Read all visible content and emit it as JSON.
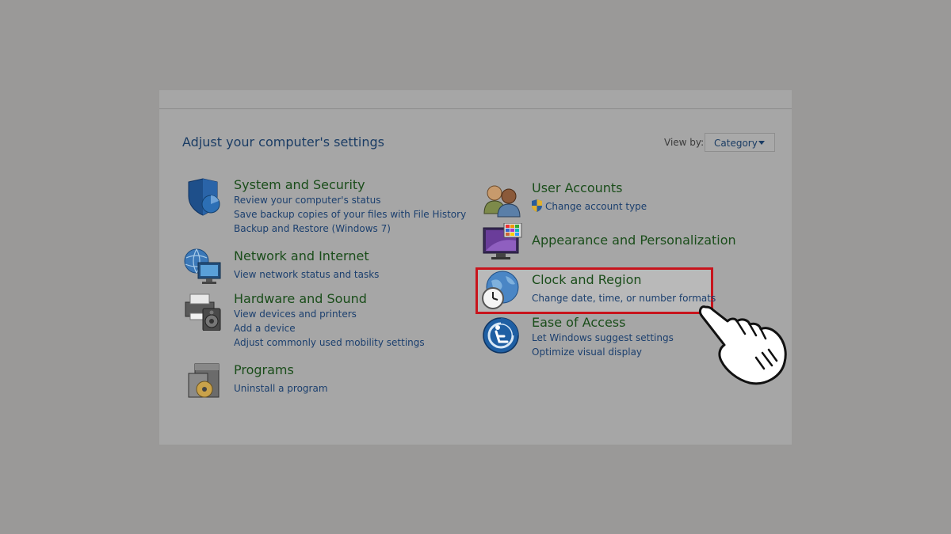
{
  "header": {
    "heading": "Adjust your computer's settings",
    "view_by_label": "View by:",
    "view_by_value": "Category"
  },
  "categories_left": [
    {
      "title": "System and Security",
      "icon": "shield-icon",
      "links": [
        "Review your computer's status",
        "Save backup copies of your files with File History",
        "Backup and Restore (Windows 7)"
      ]
    },
    {
      "title": "Network and Internet",
      "icon": "network-icon",
      "links": [
        "View network status and tasks"
      ]
    },
    {
      "title": "Hardware and Sound",
      "icon": "printer-speaker-icon",
      "links": [
        "View devices and printers",
        "Add a device",
        "Adjust commonly used mobility settings"
      ]
    },
    {
      "title": "Programs",
      "icon": "programs-icon",
      "links": [
        "Uninstall a program"
      ]
    }
  ],
  "categories_right": [
    {
      "title": "User Accounts",
      "icon": "users-icon",
      "links": [
        "Change account type"
      ]
    },
    {
      "title": "Appearance and Personalization",
      "icon": "monitor-palette-icon",
      "links": []
    },
    {
      "title": "Clock and Region",
      "icon": "globe-clock-icon",
      "links": [
        "Change date, time, or number formats"
      ]
    },
    {
      "title": "Ease of Access",
      "icon": "ease-of-access-icon",
      "links": [
        "Let Windows suggest settings",
        "Optimize visual display"
      ]
    }
  ],
  "colors": {
    "title_green": "#1a4d1a",
    "link_blue": "#1b3f6e",
    "highlight_red": "#c8141c"
  }
}
